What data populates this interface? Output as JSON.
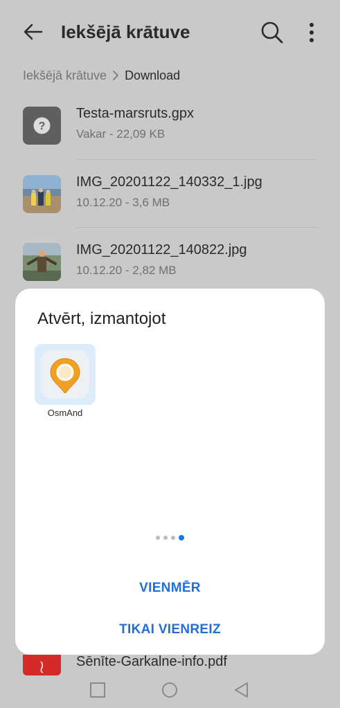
{
  "header": {
    "title": "Iekšējā krātuve"
  },
  "breadcrumb": {
    "root": "Iekšējā krātuve",
    "current": "Download"
  },
  "files": [
    {
      "name": "Testa-marsruts.gpx",
      "meta": "Vakar - 22,09 KB",
      "icon": "unknown-file-icon"
    },
    {
      "name": "IMG_20201122_140332_1.jpg",
      "meta": "10.12.20 - 3,6 MB",
      "icon": "image-thumbnail"
    },
    {
      "name": "IMG_20201122_140822.jpg",
      "meta": "10.12.20 - 2,82 MB",
      "icon": "image-thumbnail"
    }
  ],
  "partial_file": {
    "name": "Sēnīte-Garkalne-info.pdf",
    "icon": "pdf-icon"
  },
  "sheet": {
    "title": "Atvērt, izmantojot",
    "apps": [
      {
        "label": "OsmAnd",
        "icon": "osmand-icon"
      }
    ],
    "page_dots": 4,
    "active_dot": 4,
    "always_label": "VIENMĒR",
    "once_label": "TIKAI VIENREIZ"
  },
  "colors": {
    "accent": "#1f6fd6",
    "osmand_orange": "#f2a023",
    "scrim_background": "#c9c9c9"
  }
}
